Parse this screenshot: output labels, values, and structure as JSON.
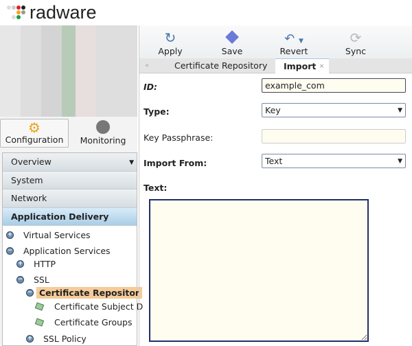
{
  "logo": {
    "text": "radware"
  },
  "mode_tabs": [
    {
      "label": "Configuration",
      "icon": "gear-icon"
    },
    {
      "label": "Monitoring",
      "icon": "pie-icon"
    }
  ],
  "nav": {
    "sections": [
      "Overview",
      "System",
      "Network",
      "Application Delivery"
    ],
    "tree": [
      "Virtual Services",
      "Application Services",
      "HTTP",
      "SSL",
      "Certificate Repositor",
      "Certificate Subject D",
      "Certificate Groups",
      "SSL Policy"
    ]
  },
  "toolbar": {
    "apply": "Apply",
    "save": "Save",
    "revert": "Revert",
    "sync": "Sync"
  },
  "tabs": {
    "collapse": "«",
    "repo": "Certificate Repository",
    "import": "Import",
    "close": "×"
  },
  "form": {
    "id_label": "ID:",
    "id_value": "example_com",
    "type_label": "Type:",
    "type_value": "Key",
    "pass_label": "Key Passphrase:",
    "pass_value": "",
    "from_label": "Import From:",
    "from_value": "Text",
    "text_label": "Text:",
    "text_value": ""
  }
}
